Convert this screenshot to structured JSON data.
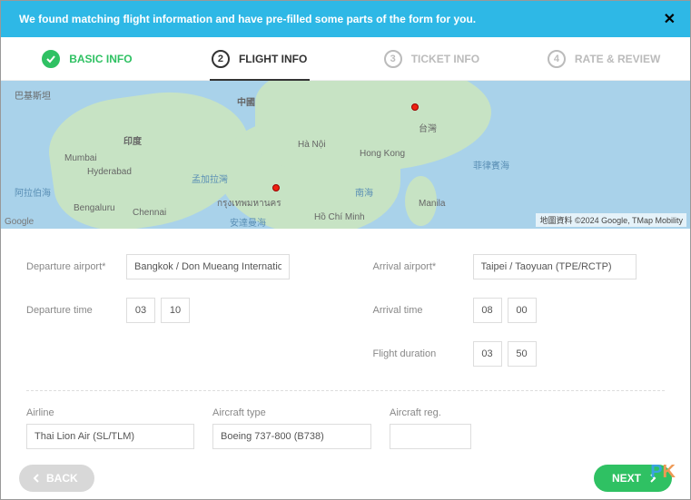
{
  "banner": {
    "text": "We found matching flight information and have pre-filled some parts of the form for you.",
    "close": "✕"
  },
  "steps": {
    "s1": {
      "num": "✓",
      "label": "BASIC INFO"
    },
    "s2": {
      "num": "2",
      "label": "FLIGHT INFO"
    },
    "s3": {
      "num": "3",
      "label": "TICKET INFO"
    },
    "s4": {
      "num": "4",
      "label": "RATE & REVIEW"
    }
  },
  "map": {
    "labels": {
      "india": "印度",
      "mumbai": "Mumbai",
      "hyd": "Hyderabad",
      "blr": "Bengaluru",
      "chen": "Chennai",
      "bkk": "กรุงเทพมหานคร",
      "hn": "Hà Nội",
      "hcm": "Hồ Chí Minh",
      "hk": "Hong Kong",
      "cn": "中國",
      "tw": "台灣",
      "mnl": "Manila",
      "pak": "巴基斯坦",
      "bay": "孟加拉灣",
      "arab": "阿拉伯海",
      "scs": "南海",
      "phsea": "菲律賓海",
      "andaman": "安達曼海"
    },
    "copyright": "地圖資料 ©2024 Google, TMap Mobility",
    "glogo": "Google"
  },
  "form": {
    "dep_airport_label": "Departure airport*",
    "dep_airport": "Bangkok / Don Mueang International",
    "dep_time_label": "Departure time",
    "dep_h": "03",
    "dep_m": "10",
    "arr_airport_label": "Arrival airport*",
    "arr_airport": "Taipei / Taoyuan (TPE/RCTP)",
    "arr_time_label": "Arrival time",
    "arr_h": "08",
    "arr_m": "00",
    "dur_label": "Flight duration",
    "dur_h": "03",
    "dur_m": "50",
    "airline_label": "Airline",
    "airline": "Thai Lion Air (SL/TLM)",
    "atype_label": "Aircraft type",
    "atype": "Boeing 737-800 (B738)",
    "areg_label": "Aircraft reg.",
    "areg": ""
  },
  "footer": {
    "back": "BACK",
    "next": "NEXT"
  },
  "watermark": {
    "p": "P",
    "k": "K"
  }
}
